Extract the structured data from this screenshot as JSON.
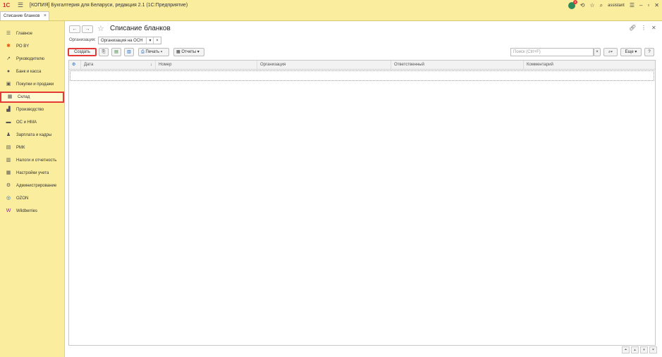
{
  "titlebar": {
    "logo": "1С",
    "title": "[КОПИЯ] Бухгалтерия для Беларуси, редакция 2.1  (1С:Предприятие)",
    "user": "assistant",
    "notification_count": "3"
  },
  "tabs": [
    {
      "label": "Списание бланков"
    }
  ],
  "sidebar": {
    "items": [
      {
        "label": "Главное",
        "icon": "☰",
        "color": "#555555"
      },
      {
        "label": "РО BY",
        "icon": "✱",
        "color": "#e65100"
      },
      {
        "label": "Руководителю",
        "icon": "↗",
        "color": "#555555"
      },
      {
        "label": "Банк и касса",
        "icon": "●",
        "color": "#555555"
      },
      {
        "label": "Покупки и продажи",
        "icon": "▣",
        "color": "#555555"
      },
      {
        "label": "Склад",
        "icon": "▦",
        "color": "#555555"
      },
      {
        "label": "Производство",
        "icon": "▟",
        "color": "#555555"
      },
      {
        "label": "ОС и НМА",
        "icon": "▬",
        "color": "#555555"
      },
      {
        "label": "Зарплата и кадры",
        "icon": "♟",
        "color": "#555555"
      },
      {
        "label": "РМК",
        "icon": "▤",
        "color": "#555555"
      },
      {
        "label": "Налоги и отчетность",
        "icon": "▥",
        "color": "#555555"
      },
      {
        "label": "Настройки учета",
        "icon": "▦",
        "color": "#555555"
      },
      {
        "label": "Администрирование",
        "icon": "⚙",
        "color": "#555555"
      },
      {
        "label": "OZON",
        "icon": "◎",
        "color": "#1565c0"
      },
      {
        "label": "Wildberries",
        "icon": "W",
        "color": "#8e24aa"
      }
    ],
    "active": "Склад"
  },
  "page": {
    "title": "Списание бланков",
    "org_label": "Организация:",
    "org_value": "Организация на ОСН",
    "create_label": "Создать",
    "print_label": "Печать",
    "reports_label": "Отчеты",
    "search_placeholder": "Поиск (Ctrl+F)",
    "more_label": "Еще",
    "help_label": "?"
  },
  "table": {
    "columns": [
      "Дата",
      "Номер",
      "Организация",
      "Ответственный",
      "Комментарий"
    ]
  }
}
